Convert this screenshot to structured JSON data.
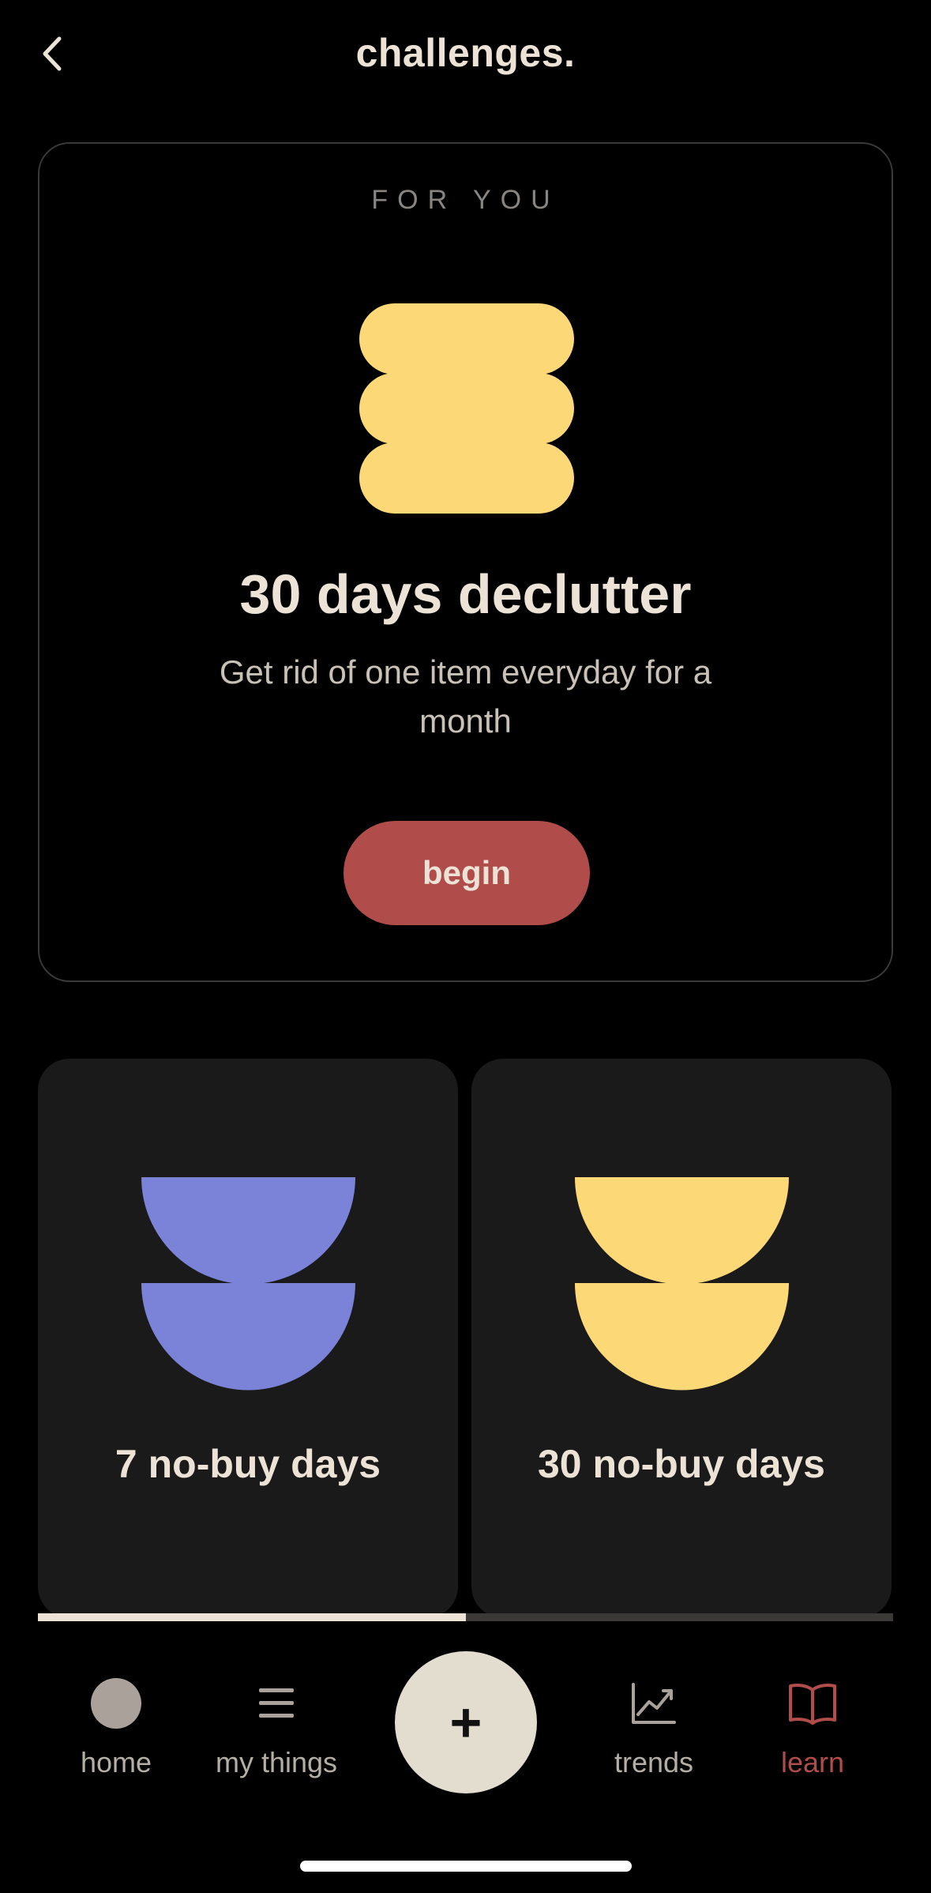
{
  "header": {
    "title": "challenges."
  },
  "featured": {
    "eyebrow": "FOR YOU",
    "title": "30 days declutter",
    "description": "Get rid of one item everyday for a month",
    "button_label": "begin",
    "illustration_color": "#fdd877"
  },
  "challenges": [
    {
      "label": "7 no-buy days",
      "illustration_color": "#7b83d8"
    },
    {
      "label": "30 no-buy days",
      "illustration_color": "#fdd877"
    }
  ],
  "carousel": {
    "progress": 0.5
  },
  "tabbar": {
    "items": [
      {
        "label": "home",
        "icon": "home-circle-icon",
        "active": false
      },
      {
        "label": "my things",
        "icon": "list-icon",
        "active": false
      },
      {
        "label": "+",
        "icon": "plus-icon",
        "active": false
      },
      {
        "label": "trends",
        "icon": "trend-chart-icon",
        "active": false
      },
      {
        "label": "learn",
        "icon": "book-icon",
        "active": true
      }
    ]
  },
  "colors": {
    "background": "#000000",
    "text": "#ece3d6",
    "accent": "#b04d4a",
    "card": "#1a1a1a"
  }
}
